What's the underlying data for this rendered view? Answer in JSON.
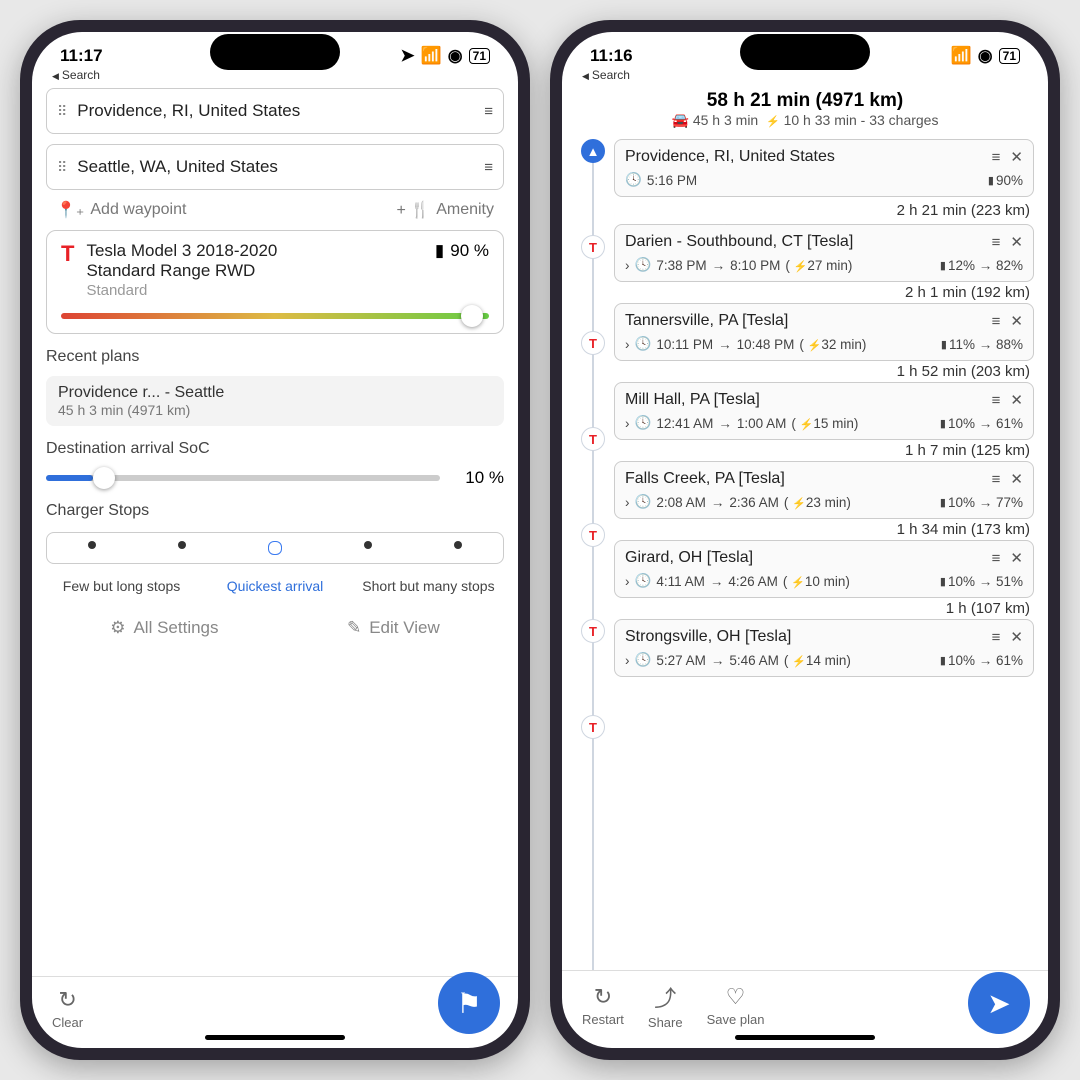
{
  "left": {
    "status": {
      "time": "11:17",
      "back": "Search",
      "battery": "71"
    },
    "origin": "Providence, RI, United States",
    "destination": "Seattle, WA, United States",
    "add_waypoint": "Add waypoint",
    "amenity": "Amenity",
    "vehicle": {
      "name_l1": "Tesla Model 3 2018-2020",
      "name_l2": "Standard Range RWD",
      "sub": "Standard",
      "pct": "90 %"
    },
    "recent_label": "Recent plans",
    "recent": {
      "title": "Providence r... - Seattle",
      "sub": "45 h 3 min (4971 km)"
    },
    "soc_label": "Destination arrival SoC",
    "soc_value": "10 %",
    "stops_label": "Charger Stops",
    "stops_left": "Few but long stops",
    "stops_mid": "Quickest arrival",
    "stops_right": "Short but many stops",
    "all_settings": "All Settings",
    "edit_view": "Edit View",
    "clear": "Clear"
  },
  "right": {
    "status": {
      "time": "11:16",
      "back": "Search",
      "battery": "71"
    },
    "summary_main": "58 h 21 min (4971 km)",
    "summary_drive": "45 h 3 min",
    "summary_charge": "10 h 33 min - 33 charges",
    "start": {
      "name": "Providence, RI, United States",
      "time": "5:16 PM",
      "pct": "90%",
      "leg": "2 h 21 min (223 km)"
    },
    "stops": [
      {
        "name": "Darien - Southbound, CT [Tesla]",
        "arr": "7:38 PM",
        "dep": "8:10 PM",
        "chg": "27 min",
        "in": "12%",
        "out": "82%",
        "leg": "2 h 1 min (192 km)"
      },
      {
        "name": "Tannersville, PA [Tesla]",
        "arr": "10:11 PM",
        "dep": "10:48 PM",
        "chg": "32 min",
        "in": "11%",
        "out": "88%",
        "leg": "1 h 52 min (203 km)"
      },
      {
        "name": "Mill Hall, PA [Tesla]",
        "arr": "12:41 AM",
        "dep": "1:00 AM",
        "chg": "15 min",
        "in": "10%",
        "out": "61%",
        "leg": "1 h 7 min (125 km)"
      },
      {
        "name": "Falls Creek, PA [Tesla]",
        "arr": "2:08 AM",
        "dep": "2:36 AM",
        "chg": "23 min",
        "in": "10%",
        "out": "77%",
        "leg": "1 h 34 min (173 km)"
      },
      {
        "name": "Girard, OH [Tesla]",
        "arr": "4:11 AM",
        "dep": "4:26 AM",
        "chg": "10 min",
        "in": "10%",
        "out": "51%",
        "leg": "1 h (107 km)"
      },
      {
        "name": "Strongsville, OH [Tesla]",
        "arr": "5:27 AM",
        "dep": "5:46 AM",
        "chg": "14 min",
        "in": "10%",
        "out": "61%",
        "leg": ""
      }
    ],
    "restart": "Restart",
    "share": "Share",
    "save": "Save plan"
  }
}
